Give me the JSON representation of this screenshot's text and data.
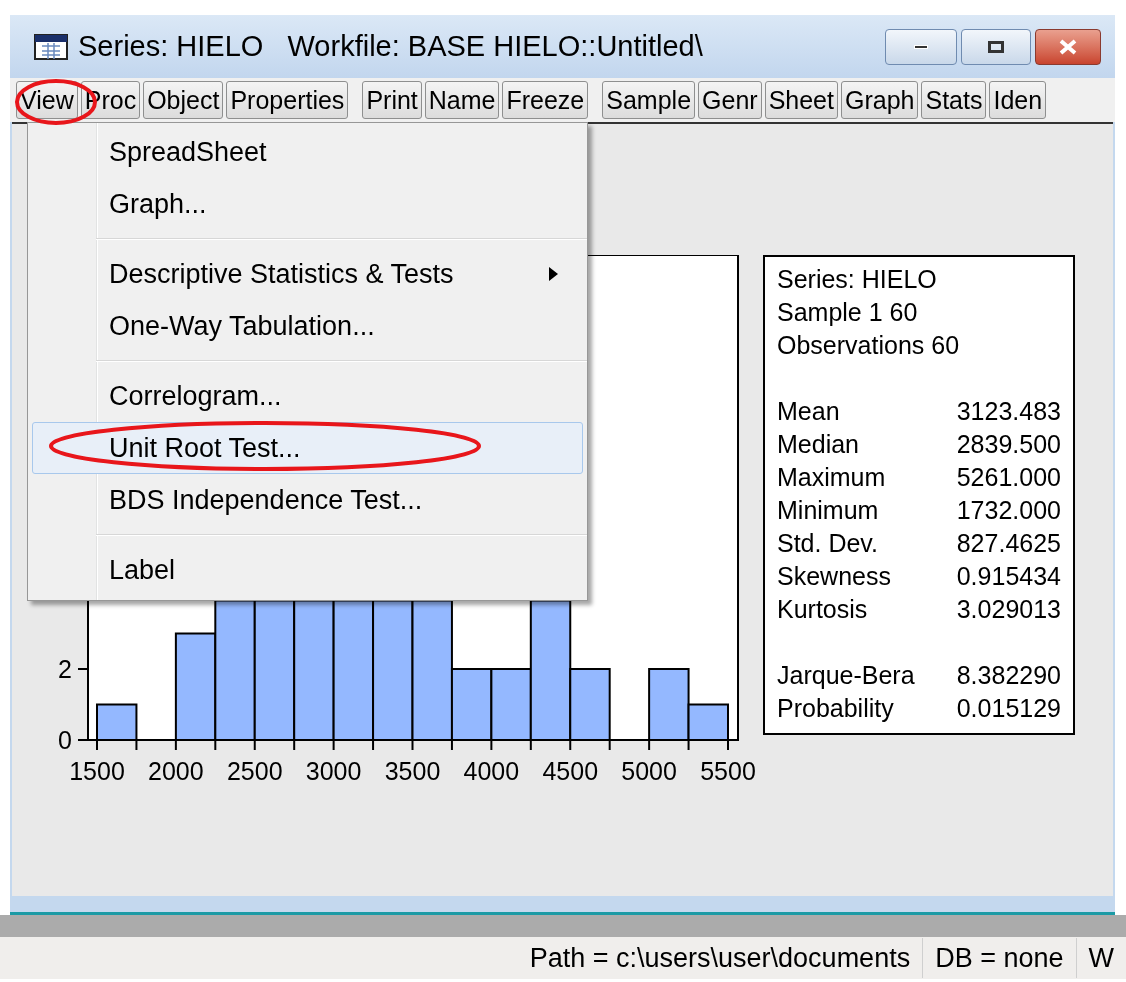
{
  "window": {
    "title": "Series: HIELO   Workfile: BASE HIELO::Untitled\\"
  },
  "toolbar": [
    [
      "View",
      "Proc",
      "Object",
      "Properties"
    ],
    [
      "Print",
      "Name",
      "Freeze"
    ],
    [
      "Sample",
      "Genr",
      "Sheet",
      "Graph",
      "Stats",
      "Iden"
    ]
  ],
  "menu": {
    "items": [
      {
        "kind": "item",
        "label": "SpreadSheet",
        "selected": false,
        "has_submenu": false
      },
      {
        "kind": "item",
        "label": "Graph...",
        "selected": false,
        "has_submenu": false
      },
      {
        "kind": "separator"
      },
      {
        "kind": "item",
        "label": "Descriptive Statistics & Tests",
        "selected": false,
        "has_submenu": true
      },
      {
        "kind": "item",
        "label": "One-Way Tabulation...",
        "selected": false,
        "has_submenu": false
      },
      {
        "kind": "separator"
      },
      {
        "kind": "item",
        "label": "Correlogram...",
        "selected": false,
        "has_submenu": false
      },
      {
        "kind": "item",
        "label": "Unit Root Test...",
        "selected": true,
        "has_submenu": false
      },
      {
        "kind": "item",
        "label": "BDS Independence Test...",
        "selected": false,
        "has_submenu": false
      },
      {
        "kind": "separator"
      },
      {
        "kind": "item",
        "label": "Label",
        "selected": false,
        "has_submenu": false
      }
    ]
  },
  "histogram": {
    "yticks": [
      "2",
      "0"
    ],
    "xticks": [
      "1500",
      "2000",
      "2500",
      "3000",
      "3500",
      "4000",
      "4500",
      "5000",
      "5500"
    ]
  },
  "stats": {
    "header": [
      "Series: HIELO",
      "Sample 1 60",
      "Observations 60"
    ],
    "groups": [
      [
        {
          "label": "Mean",
          "value": "3123.483"
        },
        {
          "label": "Median",
          "value": "2839.500"
        },
        {
          "label": "Maximum",
          "value": "5261.000"
        },
        {
          "label": "Minimum",
          "value": "1732.000"
        },
        {
          "label": "Std. Dev.",
          "value": "827.4625"
        },
        {
          "label": "Skewness",
          "value": "0.915434"
        },
        {
          "label": "Kurtosis",
          "value": "3.029013"
        }
      ],
      [
        {
          "label": "Jarque-Bera",
          "value": "8.382290"
        },
        {
          "label": "Probability",
          "value": "0.015129"
        }
      ]
    ]
  },
  "status_bar": [
    "Path = c:\\users\\user\\documents",
    "DB = none",
    "W"
  ]
}
